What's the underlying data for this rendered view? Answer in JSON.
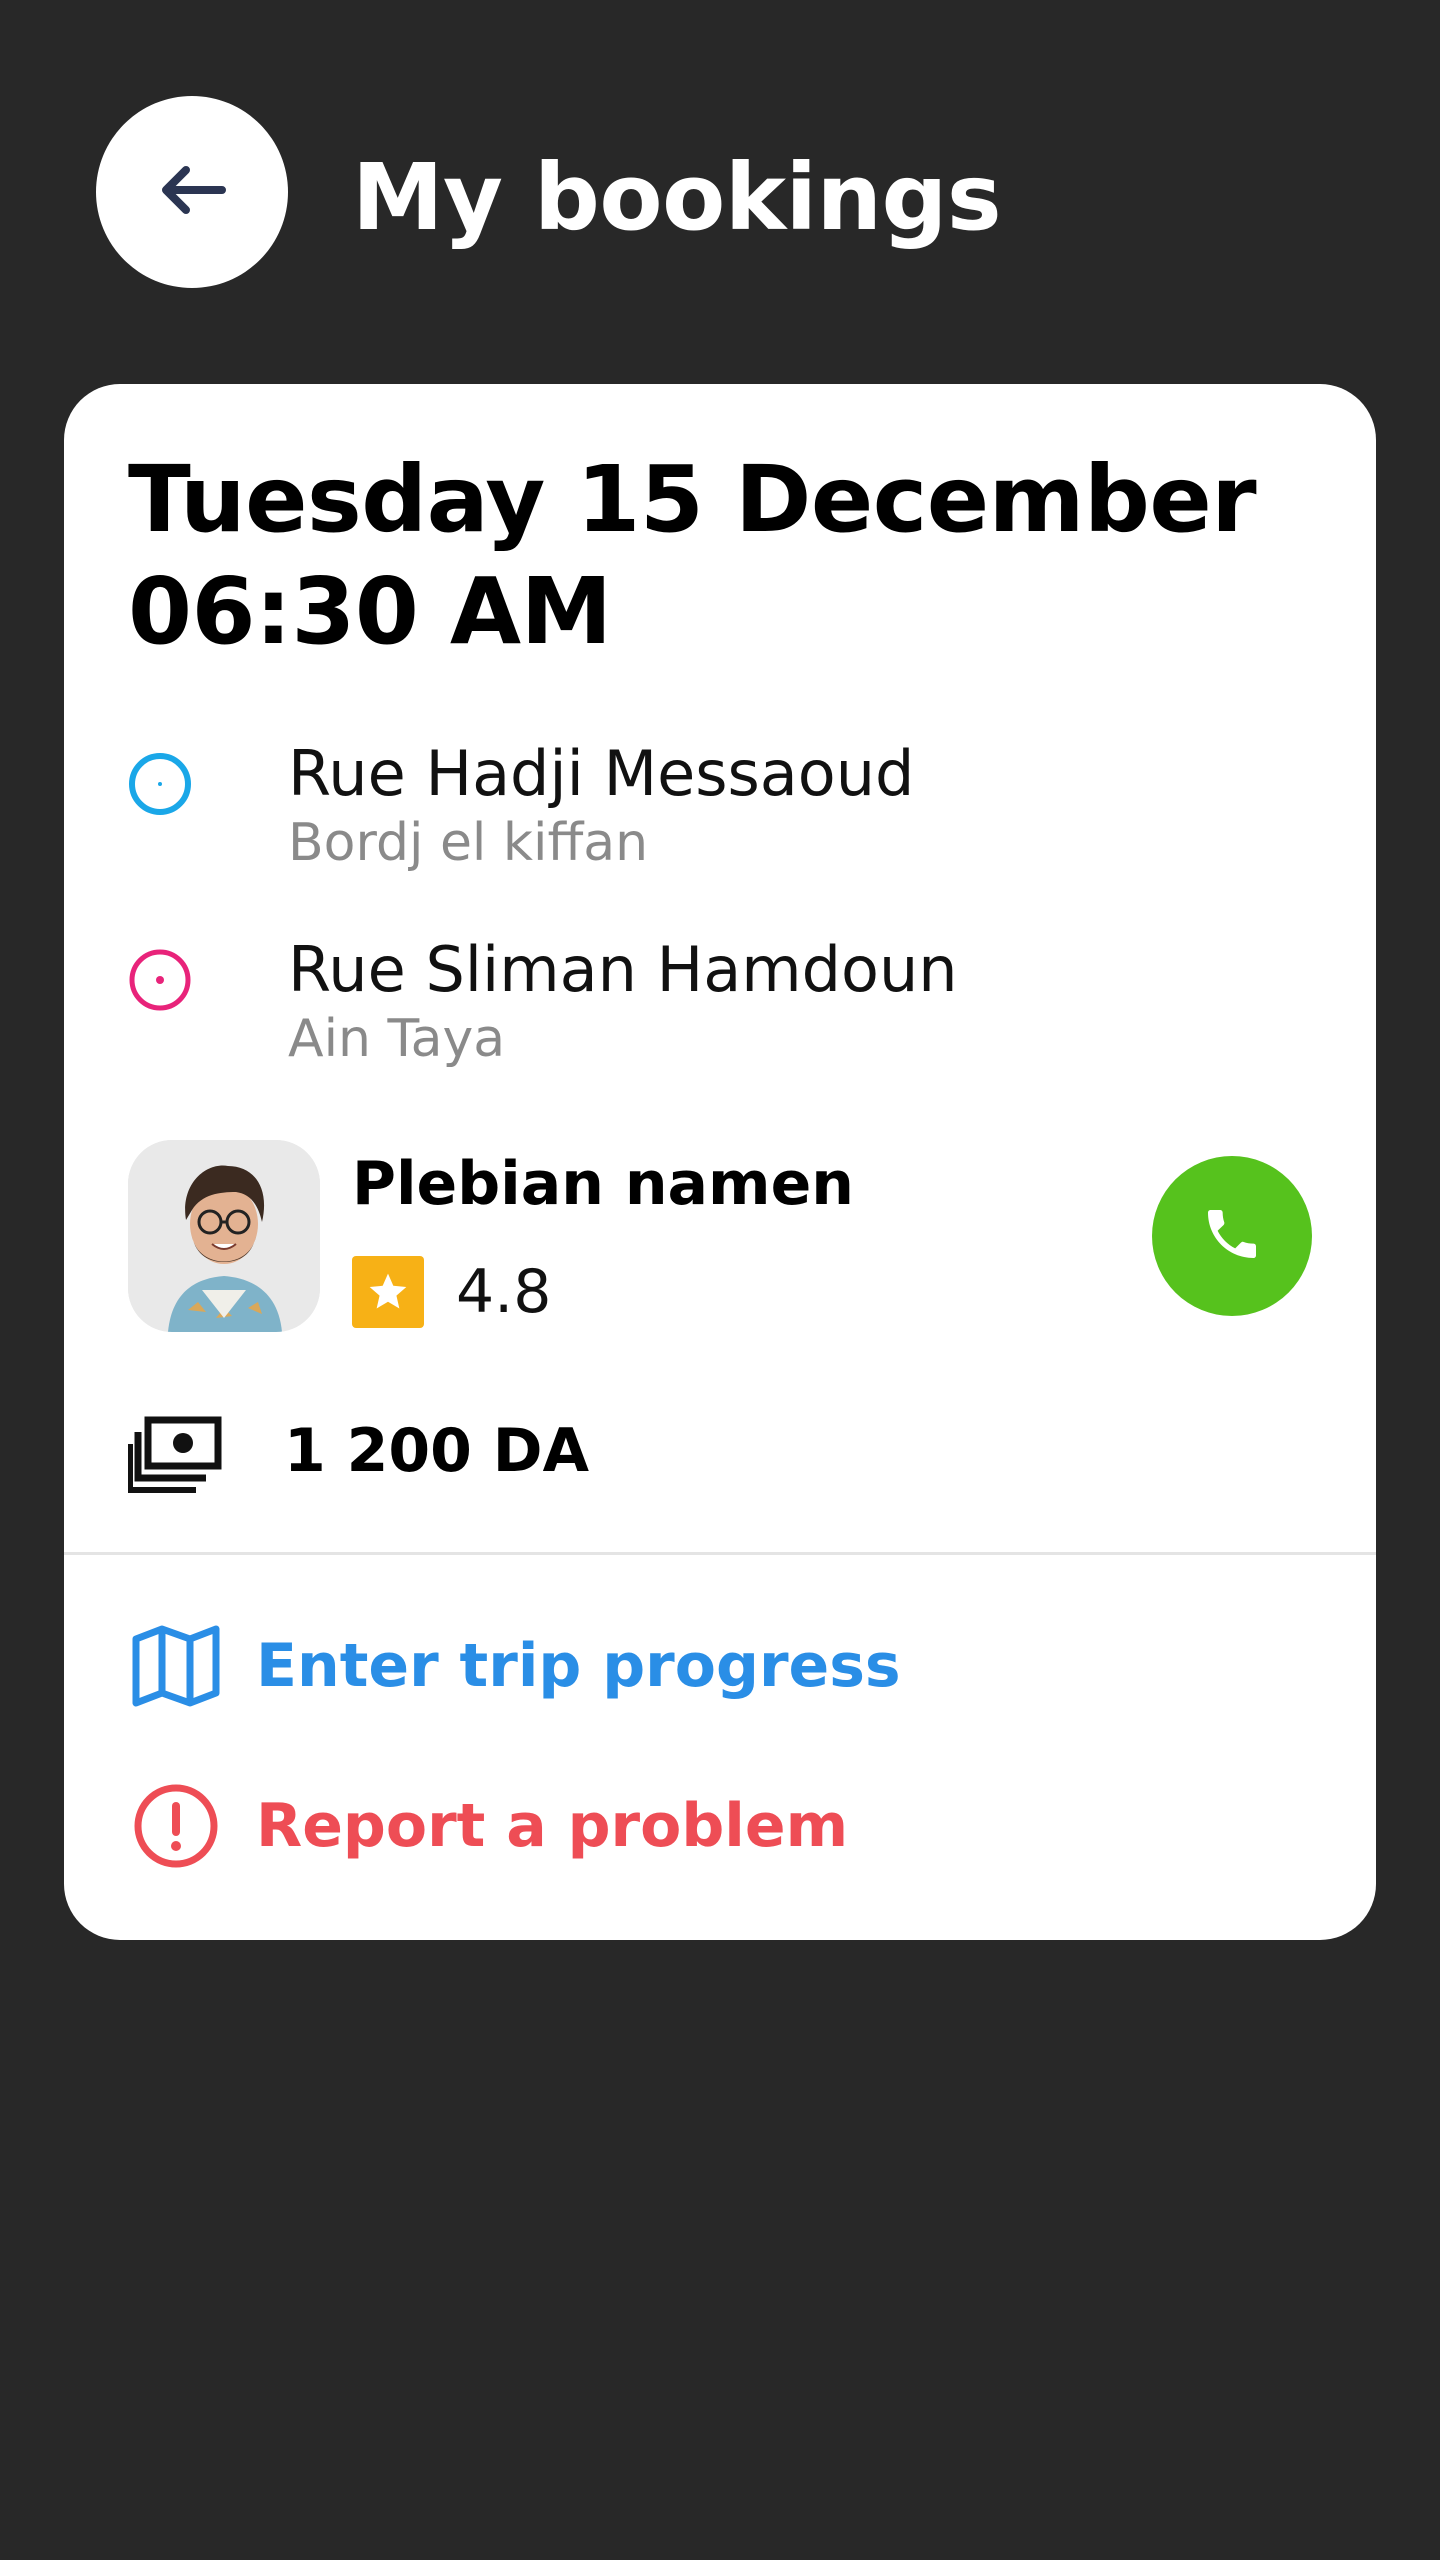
{
  "header": {
    "title": "My bookings",
    "back_icon": "arrow-left-icon"
  },
  "booking": {
    "date_line": "Tuesday 15 December",
    "time_line": "06:30 AM",
    "pickup": {
      "name": "Rue Hadji Messaoud",
      "area": "Bordj el kiffan",
      "color": "#1aa7e8"
    },
    "dropoff": {
      "name": "Rue Sliman Hamdoun",
      "area": "Ain Taya",
      "color": "#e8237a"
    },
    "driver": {
      "name": "Plebian namen",
      "rating": "4.8",
      "star_color": "#f7b116",
      "call_color": "#56c21d"
    },
    "price": "1 200 DA",
    "actions": {
      "progress": "Enter trip progress",
      "problem": "Report a problem"
    }
  },
  "colors": {
    "background": "#282828",
    "accent_blue": "#2a8ee6",
    "alert_red": "#ee4d55"
  }
}
